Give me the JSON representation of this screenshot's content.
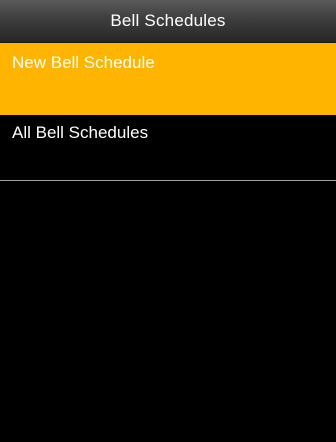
{
  "header": {
    "title": "Bell Schedules"
  },
  "menu": {
    "items": [
      {
        "label": "New Bell Schedule",
        "selected": true
      },
      {
        "label": "All Bell Schedules",
        "selected": false
      }
    ]
  },
  "colors": {
    "selected_background": "#ffb400",
    "background": "#000000",
    "text": "#ffffff",
    "divider": "#a0a0a0"
  }
}
